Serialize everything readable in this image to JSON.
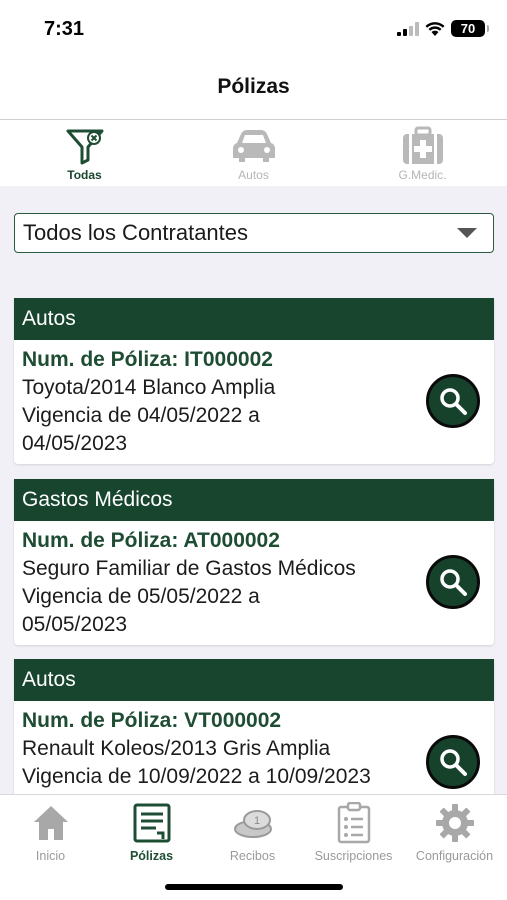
{
  "status": {
    "time": "7:31",
    "battery": "70"
  },
  "nav": {
    "title": "Pólizas"
  },
  "filter_tabs": [
    {
      "label": "Todas",
      "icon": "filter-icon",
      "active": true
    },
    {
      "label": "Autos",
      "icon": "car-icon",
      "active": false
    },
    {
      "label": "G.Medic.",
      "icon": "medical-kit-icon",
      "active": false
    }
  ],
  "contratante_select": {
    "value": "Todos los Contratantes"
  },
  "policies": [
    {
      "category": "Autos",
      "policy_number": "Num. de Póliza: IT000002",
      "description": "Toyota/2014 Blanco Amplia",
      "validity_line1": "Vigencia de 04/05/2022 a",
      "validity_line2": "04/05/2023"
    },
    {
      "category": "Gastos Médicos",
      "policy_number": "Num. de Póliza: AT000002",
      "description": "Seguro Familiar de Gastos Médicos",
      "validity_line1": "Vigencia de 05/05/2022 a",
      "validity_line2": "05/05/2023"
    },
    {
      "category": "Autos",
      "policy_number": "Num. de Póliza: VT000002",
      "description": "Renault Koleos/2013 Gris Amplia",
      "validity_line1": "Vigencia de 10/09/2022 a 10/09/2023",
      "validity_line2": ""
    }
  ],
  "tab_bar": [
    {
      "label": "Inicio",
      "icon": "home-icon",
      "active": false
    },
    {
      "label": "Pólizas",
      "icon": "policy-document-icon",
      "active": true
    },
    {
      "label": "Recibos",
      "icon": "coins-icon",
      "active": false
    },
    {
      "label": "Suscripciones",
      "icon": "clipboard-icon",
      "active": false
    },
    {
      "label": "Configuración",
      "icon": "gear-icon",
      "active": false
    }
  ],
  "colors": {
    "brand_green": "#17452e",
    "background": "#f0f0f6"
  }
}
